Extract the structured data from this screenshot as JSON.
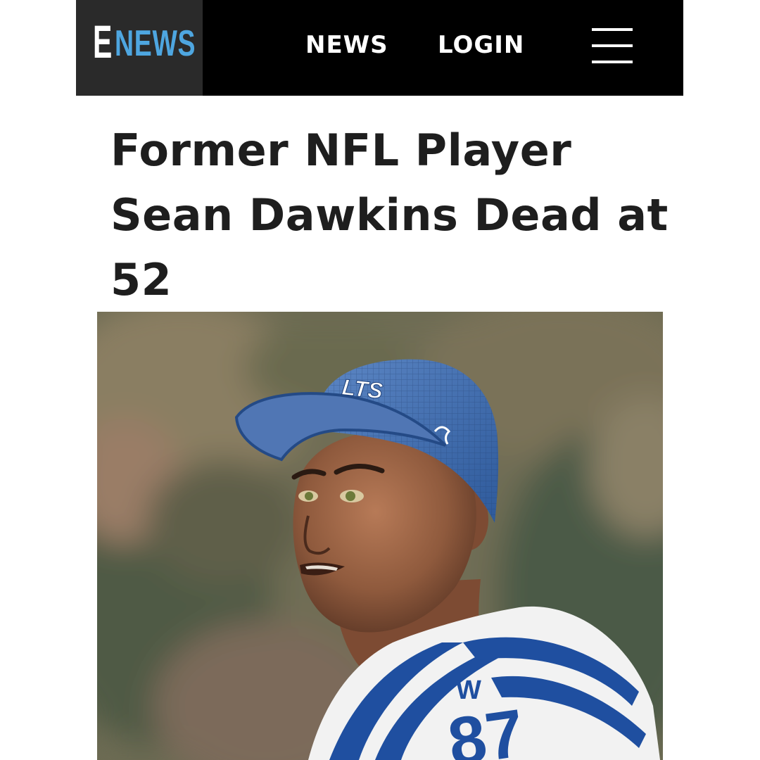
{
  "header": {
    "logo_e": "E",
    "logo_news": "NEWS",
    "nav": [
      {
        "label": "NEWS"
      },
      {
        "label": "LOGIN"
      }
    ],
    "menu_icon": "hamburger-menu-icon"
  },
  "article": {
    "headline": "Former NFL Player Sean Dawkins Dead at 52",
    "hero_image": {
      "cap_text": "LTS",
      "sleeve_logo": "W",
      "jersey_number": "87"
    }
  },
  "colors": {
    "header_bg": "#000000",
    "logo_bg": "#2a2a2a",
    "logo_accent": "#4ea6e0",
    "headline_text": "#1e1e1e",
    "jersey_blue": "#1f4fa0"
  }
}
